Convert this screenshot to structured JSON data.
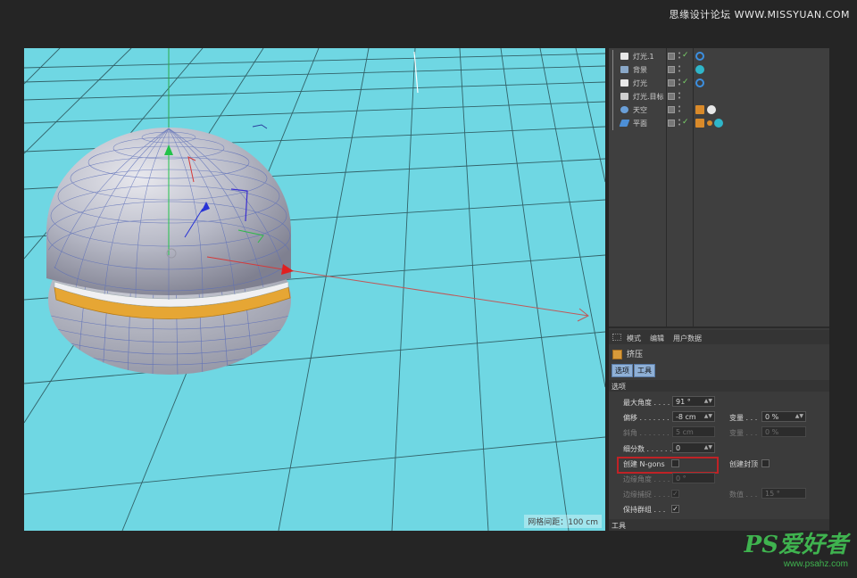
{
  "watermark": {
    "top": "思缘设计论坛 WWW.MISSYUAN.COM",
    "logo": "PS爱好者",
    "url": "www.psahz.com"
  },
  "viewport": {
    "grid_readout": "网格间距：100 cm",
    "background": "#6fd7e3"
  },
  "objects": [
    {
      "name": "灯光.1",
      "icon": "light-icon",
      "color": "#e8e8e8",
      "tag": "target-tag-icon",
      "tag_color": "#3c8fe0"
    },
    {
      "name": "背景",
      "icon": "background-icon",
      "color": "#8aa8c8",
      "tag": "material-ball-icon",
      "tag_color": "#2fb6c9"
    },
    {
      "name": "灯光",
      "icon": "light-icon",
      "color": "#e8e8e8",
      "tag": "target-tag-icon",
      "tag_color": "#3c8fe0"
    },
    {
      "name": "灯光.目标",
      "icon": "null-icon",
      "color": "#cfcfcf",
      "tag": "",
      "tag_color": ""
    },
    {
      "name": "天空",
      "icon": "sky-icon",
      "color": "#6a9fd8",
      "tag": "sky-tag-icon",
      "tag_color": "#e8e8e8"
    },
    {
      "name": "平面",
      "icon": "plane-icon",
      "color": "#4d8fd6",
      "tag": "material-ball-icon",
      "tag_color": "#2fb6c9"
    }
  ],
  "attributes": {
    "menu": [
      "模式",
      "编辑",
      "用户数据"
    ],
    "tool_name": "挤压",
    "tabs": [
      "选项",
      "工具"
    ],
    "section_options": "选项",
    "section_tool": "工具",
    "max_angle": {
      "label": "最大角度 . . . .",
      "value": "91 °"
    },
    "offset": {
      "label": "偏移 . . . . . . .",
      "value": "-8 cm"
    },
    "variance1": {
      "label": "变量 . . .",
      "value": "0 %"
    },
    "bevel": {
      "label": "斜角 . . . . . . .",
      "value": "5 cm"
    },
    "variance2": {
      "label": "变量 . . .",
      "value": "0 %"
    },
    "subdivision": {
      "label": "细分数 . . . . . .",
      "value": "0"
    },
    "create_ngons": {
      "label": "创建 N-gons",
      "checked": false
    },
    "create_caps": {
      "label": "创建封顶",
      "checked": false
    },
    "edge_angle": {
      "label": "边缘角度 . . . .",
      "value": "0 °"
    },
    "edge_snap": {
      "label": "边缘捕捉 . . . .",
      "checked": true
    },
    "value_field": {
      "label": "数值 . . .",
      "value": "15 °"
    },
    "keep_groups": {
      "label": "保持群组 . . .",
      "checked": true
    }
  },
  "highlight_color": "#c02226"
}
